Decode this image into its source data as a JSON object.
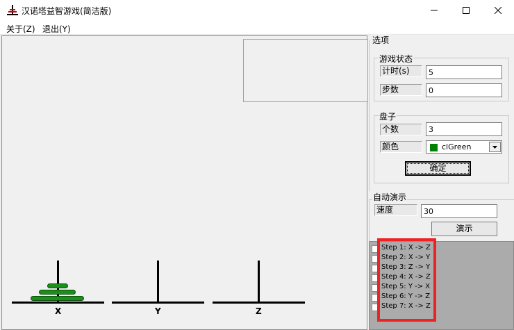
{
  "window": {
    "title": "汉诺塔益智游戏(简洁版)",
    "icon": "hanoi-tower-icon"
  },
  "menu": {
    "items": [
      {
        "label": "关于(Z)"
      },
      {
        "label": "退出(Y)"
      }
    ]
  },
  "pegs": [
    {
      "label": "X",
      "disks": 3
    },
    {
      "label": "Y",
      "disks": 0
    },
    {
      "label": "Z",
      "disks": 0
    }
  ],
  "colors": {
    "disk": "#1a8f1a",
    "highlight": "#ee2222",
    "steps_bg": "#ababab"
  },
  "options": {
    "title": "选项",
    "game_status": {
      "title": "游戏状态",
      "timer_label": "计时(s)",
      "timer_value": "5",
      "steps_label": "步数",
      "steps_value": "0"
    },
    "disks": {
      "title": "盘子",
      "count_label": "个数",
      "count_value": "3",
      "color_label": "颜色",
      "color_value": "clGreen",
      "confirm_label": "确定"
    }
  },
  "auto_demo": {
    "title": "自动演示",
    "speed_label": "速度",
    "speed_value": "30",
    "demo_label": "演示",
    "steps": [
      "Step 1: X -> Z",
      "Step 2: X -> Y",
      "Step 3: Z -> Y",
      "Step 4: X -> Z",
      "Step 5: Y -> X",
      "Step 6: Y -> Z",
      "Step 7: X -> Z"
    ]
  }
}
